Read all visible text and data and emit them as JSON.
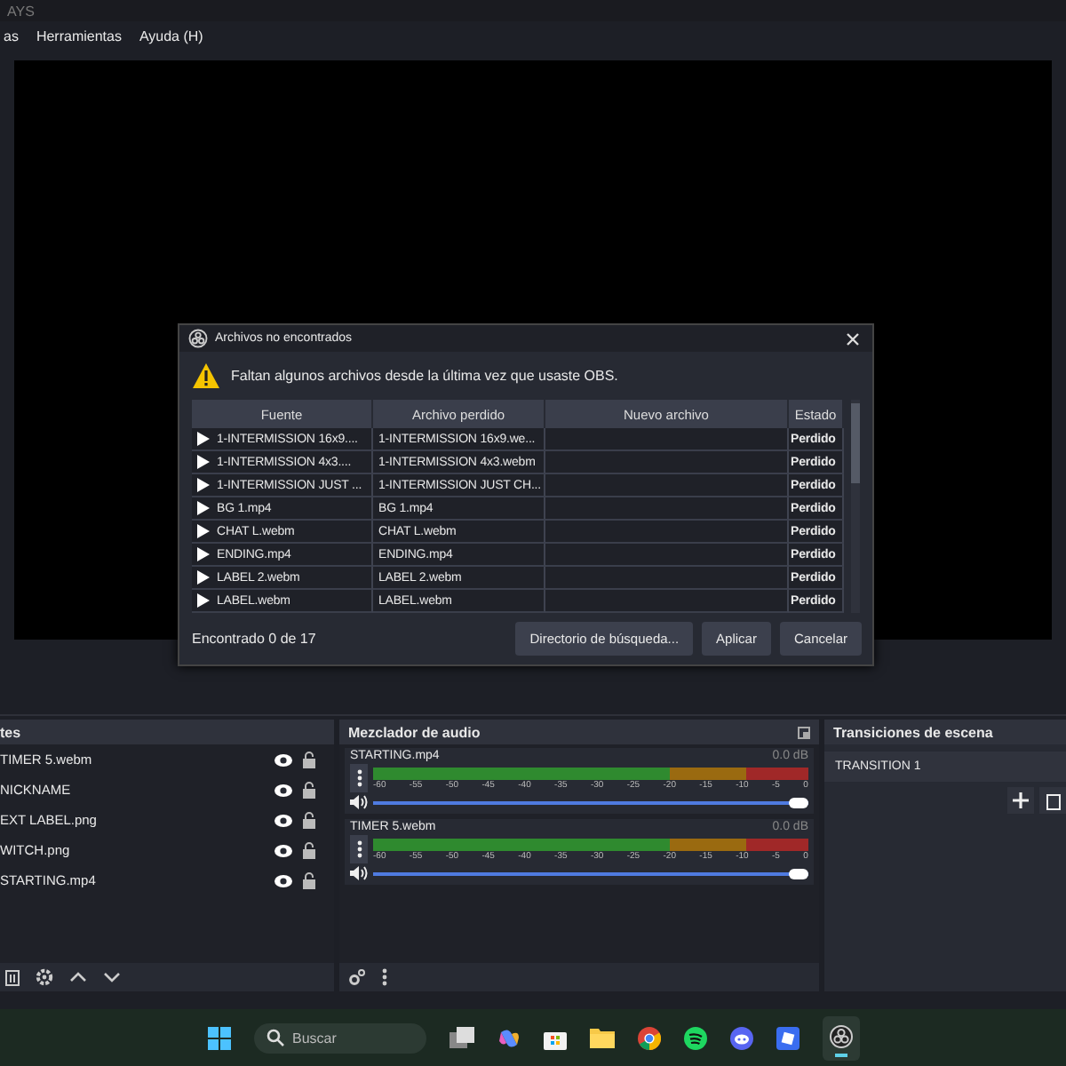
{
  "window": {
    "title": "AYS"
  },
  "menu": [
    "as",
    "Herramientas",
    "Ayuda (H)"
  ],
  "dialog": {
    "title": "Archivos no encontrados",
    "message": "Faltan algunos archivos desde la última vez que usaste OBS.",
    "columns": [
      "Fuente",
      "Archivo perdido",
      "Nuevo archivo",
      "Estado"
    ],
    "rows": [
      {
        "source": "1-INTERMISSION 16x9....",
        "missing": "1-INTERMISSION 16x9.we...",
        "new": "",
        "status": "Perdido"
      },
      {
        "source": "1-INTERMISSION 4x3....",
        "missing": "1-INTERMISSION 4x3.webm",
        "new": "",
        "status": "Perdido"
      },
      {
        "source": "1-INTERMISSION JUST ...",
        "missing": "1-INTERMISSION JUST CH...",
        "new": "",
        "status": "Perdido"
      },
      {
        "source": "BG 1.mp4",
        "missing": "BG 1.mp4",
        "new": "",
        "status": "Perdido"
      },
      {
        "source": "CHAT L.webm",
        "missing": "CHAT L.webm",
        "new": "",
        "status": "Perdido"
      },
      {
        "source": "ENDING.mp4",
        "missing": "ENDING.mp4",
        "new": "",
        "status": "Perdido"
      },
      {
        "source": "LABEL 2.webm",
        "missing": "LABEL 2.webm",
        "new": "",
        "status": "Perdido"
      },
      {
        "source": "LABEL.webm",
        "missing": "LABEL.webm",
        "new": "",
        "status": "Perdido"
      }
    ],
    "found": "Encontrado 0 de 17",
    "buttons": [
      "Directorio de búsqueda...",
      "Aplicar",
      "Cancelar"
    ]
  },
  "sources": {
    "title": "tes",
    "items": [
      {
        "name": "TIMER 5.webm",
        "visible": true
      },
      {
        "name": "NICKNAME",
        "visible": true
      },
      {
        "name": "EXT LABEL.png",
        "visible": true
      },
      {
        "name": "WITCH.png",
        "visible": true
      },
      {
        "name": "STARTING.mp4",
        "visible": true
      }
    ]
  },
  "mixer": {
    "title": "Mezclador de audio",
    "channels": [
      {
        "name": "STARTING.mp4",
        "reading": "0.0 dB",
        "level": 1,
        "ticks": [
          "-60",
          "-55",
          "-50",
          "-45",
          "-40",
          "-35",
          "-30",
          "-25",
          "-20",
          "-15",
          "-10",
          "-5",
          "0"
        ]
      },
      {
        "name": "TIMER 5.webm",
        "reading": "0.0 dB",
        "level": 1,
        "ticks": [
          "-60",
          "-55",
          "-50",
          "-45",
          "-40",
          "-35",
          "-30",
          "-25",
          "-20",
          "-15",
          "-10",
          "-5",
          "0"
        ]
      }
    ]
  },
  "transitions": {
    "title": "Transiciones de escena",
    "items": [
      "TRANSITION 1"
    ]
  },
  "taskbar": {
    "search_placeholder": "Buscar"
  }
}
